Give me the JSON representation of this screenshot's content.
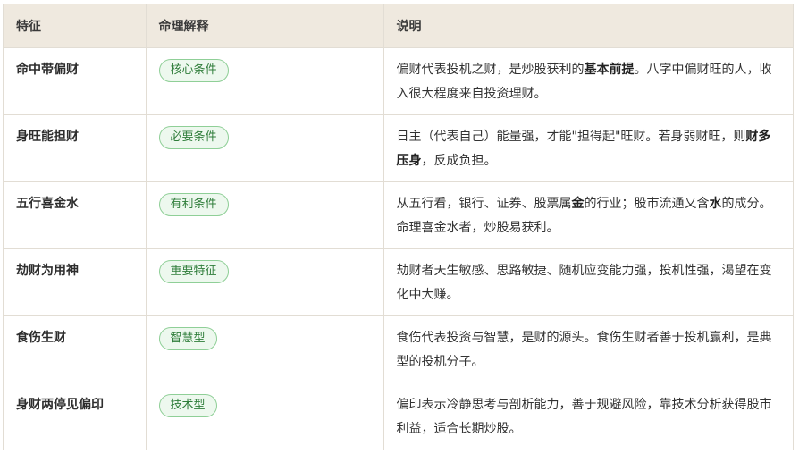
{
  "table": {
    "headers": [
      "特征",
      "命理解释",
      "说明"
    ],
    "rows": [
      {
        "feature": "命中带偏财",
        "badge": "核心条件",
        "desc": [
          {
            "t": "偏财代表投机之财，是炒股获利的"
          },
          {
            "t": "基本前提",
            "b": true
          },
          {
            "t": "。八字中偏财旺的人，收入很大程度来自投资理财。"
          }
        ]
      },
      {
        "feature": "身旺能担财",
        "badge": "必要条件",
        "desc": [
          {
            "t": "日主（代表自己）能量强，才能\"担得起\"旺财。若身弱财旺，则"
          },
          {
            "t": "财多压身",
            "b": true
          },
          {
            "t": "，反成负担。"
          }
        ]
      },
      {
        "feature": "五行喜金水",
        "badge": "有利条件",
        "desc": [
          {
            "t": "从五行看，银行、证券、股票属"
          },
          {
            "t": "金",
            "b": true
          },
          {
            "t": "的行业；股市流通又含"
          },
          {
            "t": "水",
            "b": true
          },
          {
            "t": "的成分。命理喜金水者，炒股易获利。"
          }
        ]
      },
      {
        "feature": "劫财为用神",
        "badge": "重要特征",
        "desc": [
          {
            "t": "劫财者天生敏感、思路敏捷、随机应变能力强，投机性强，渴望在变化中大赚。"
          }
        ]
      },
      {
        "feature": "食伤生财",
        "badge": "智慧型",
        "desc": [
          {
            "t": "食伤代表投资与智慧，是财的源头。食伤生财者善于投机赢利，是典型的投机分子。"
          }
        ]
      },
      {
        "feature": "身财两停见偏印",
        "badge": "技术型",
        "desc": [
          {
            "t": "偏印表示冷静思考与剖析能力，善于规避风险，靠技术分析获得股市利益，适合长期炒股。"
          }
        ]
      }
    ]
  }
}
